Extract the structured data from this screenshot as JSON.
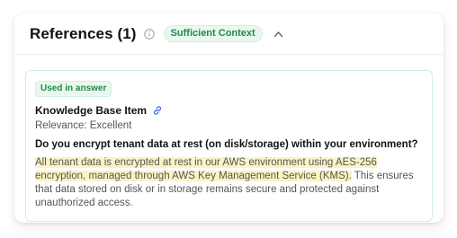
{
  "references": {
    "title": "References (1)",
    "context_badge": "Sufficient Context",
    "items": [
      {
        "status_badge": "Used in answer",
        "source": "Knowledge Base Item",
        "relevance": "Relevance: Excellent",
        "question": "Do you encrypt tenant data at rest (on disk/storage) within your environment?",
        "answer_highlighted": "All tenant data is encrypted at rest in our AWS environment using AES-256 encryption, managed through AWS Key Management Service (KMS).",
        "answer_rest": " This ensures that data stored on disk or in storage remains secure and protected against unauthorized access."
      }
    ]
  },
  "colors": {
    "accent_green": "#1f8a4c",
    "badge_bg": "#eaf7ef",
    "highlight": "#fbf3c3",
    "item_border": "#cfeee3"
  },
  "icons": {
    "info": "info-icon",
    "collapse": "chevron-up-icon",
    "link": "link-icon"
  }
}
